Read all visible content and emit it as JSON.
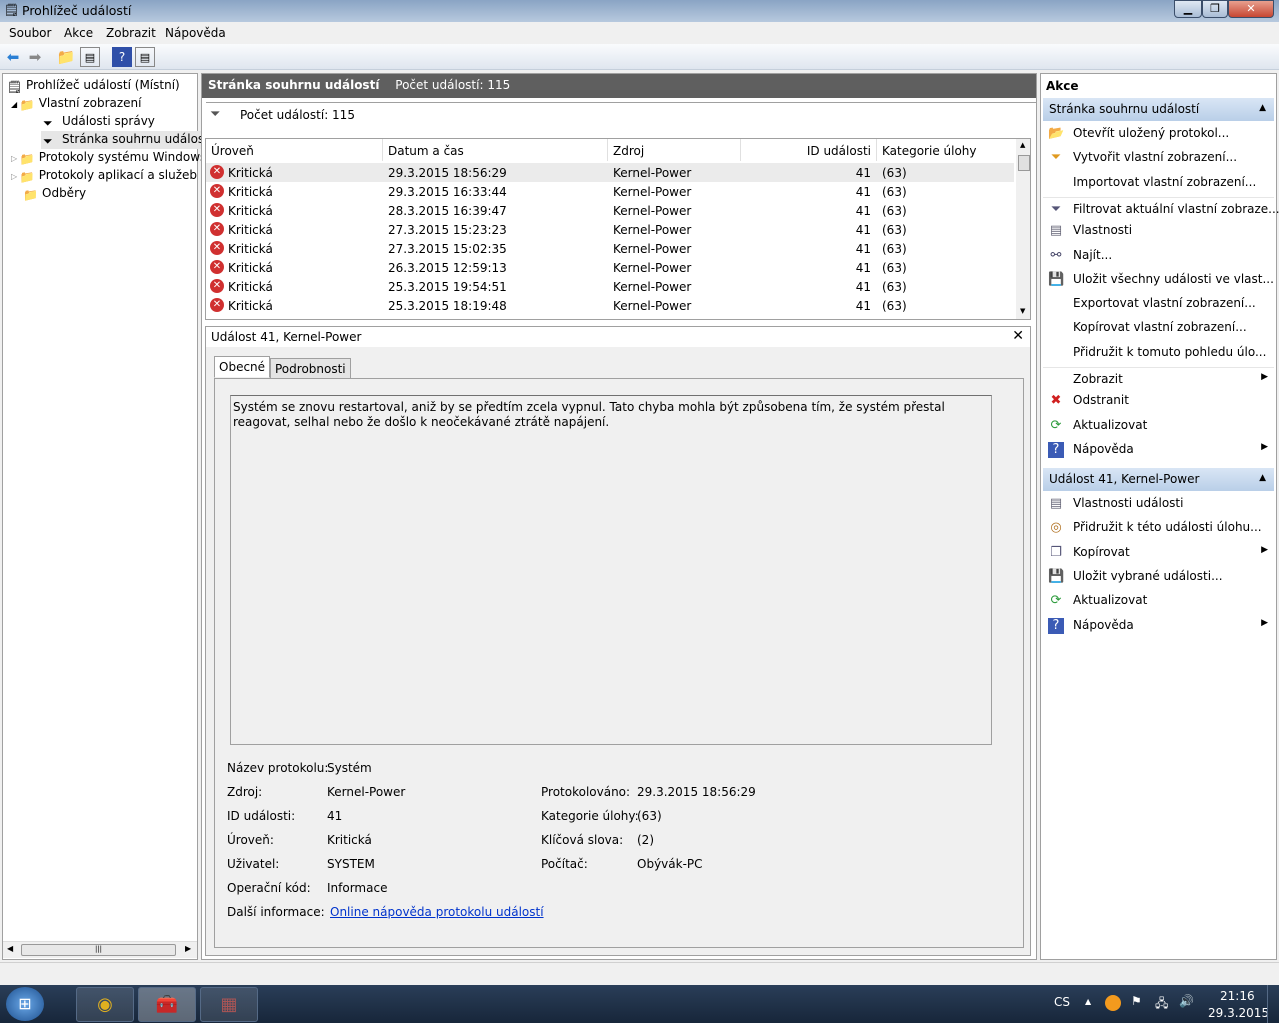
{
  "window": {
    "title": "Prohlížeč událostí"
  },
  "menu": [
    "Soubor",
    "Akce",
    "Zobrazit",
    "Nápověda"
  ],
  "tree": {
    "root": "Prohlížeč událostí (Místní)",
    "custom_views": "Vlastní zobrazení",
    "admin_events": "Události správy",
    "summary_page": "Stránka souhrnu událostí",
    "windows_logs": "Protokoly systému Windows",
    "app_logs": "Protokoly aplikací a služeb",
    "subscriptions": "Odběry"
  },
  "center": {
    "title": "Stránka souhrnu událostí",
    "count_header": "Počet událostí: 115",
    "count_line": "Počet událostí: 115",
    "columns": [
      "Úroveň",
      "Datum a čas",
      "Zdroj",
      "ID události",
      "Kategorie úlohy"
    ],
    "rows": [
      [
        "Kritická",
        "29.3.2015 18:56:29",
        "Kernel-Power",
        "41",
        "(63)"
      ],
      [
        "Kritická",
        "29.3.2015 16:33:44",
        "Kernel-Power",
        "41",
        "(63)"
      ],
      [
        "Kritická",
        "28.3.2015 16:39:47",
        "Kernel-Power",
        "41",
        "(63)"
      ],
      [
        "Kritická",
        "27.3.2015 15:23:23",
        "Kernel-Power",
        "41",
        "(63)"
      ],
      [
        "Kritická",
        "27.3.2015 15:02:35",
        "Kernel-Power",
        "41",
        "(63)"
      ],
      [
        "Kritická",
        "26.3.2015 12:59:13",
        "Kernel-Power",
        "41",
        "(63)"
      ],
      [
        "Kritická",
        "25.3.2015 19:54:51",
        "Kernel-Power",
        "41",
        "(63)"
      ],
      [
        "Kritická",
        "25.3.2015 18:19:48",
        "Kernel-Power",
        "41",
        "(63)"
      ]
    ]
  },
  "detail": {
    "title": "Událost 41, Kernel-Power",
    "tabs": [
      "Obecné",
      "Podrobnosti"
    ],
    "description": "Systém se znovu restartoval, aniž by se předtím zcela vypnul. Tato chyba mohla být způsobena tím, že systém přestal reagovat, selhal nebo že došlo k neočekávané ztrátě napájení.",
    "props_left": [
      [
        "Název protokolu:",
        "Systém"
      ],
      [
        "Zdroj:",
        "Kernel-Power"
      ],
      [
        "ID události:",
        "41"
      ],
      [
        "Úroveň:",
        "Kritická"
      ],
      [
        "Uživatel:",
        "SYSTEM"
      ],
      [
        "Operační kód:",
        "Informace"
      ]
    ],
    "props_right": [
      [
        "Protokolováno:",
        "29.3.2015 18:56:29"
      ],
      [
        "Kategorie úlohy:",
        "(63)"
      ],
      [
        "Klíčová slova:",
        "(2)"
      ],
      [
        "Počítač:",
        "Obývák-PC"
      ]
    ],
    "more_info_label": "Další informace:",
    "more_info_link": "Online nápověda protokolu událostí"
  },
  "actions": {
    "title": "Akce",
    "section1": "Stránka souhrnu událostí",
    "items1": [
      {
        "icon": "open-folder",
        "label": "Otevřít uložený protokol..."
      },
      {
        "icon": "funnel-new",
        "label": "Vytvořit vlastní zobrazení..."
      },
      {
        "icon": "",
        "label": "Importovat vlastní zobrazení..."
      },
      {
        "icon": "funnel",
        "label": "Filtrovat aktuální vlastní zobraze..."
      },
      {
        "icon": "properties",
        "label": "Vlastnosti"
      },
      {
        "icon": "binoculars",
        "label": "Najít..."
      },
      {
        "icon": "save",
        "label": "Uložit všechny události ve vlast..."
      },
      {
        "icon": "",
        "label": "Exportovat vlastní zobrazení..."
      },
      {
        "icon": "",
        "label": "Kopírovat vlastní zobrazení..."
      },
      {
        "icon": "",
        "label": "Přidružit k tomuto pohledu úlo..."
      },
      {
        "icon": "",
        "label": "Zobrazit",
        "submenu": true
      },
      {
        "icon": "delete",
        "label": "Odstranit"
      },
      {
        "icon": "refresh",
        "label": "Aktualizovat"
      },
      {
        "icon": "help",
        "label": "Nápověda",
        "submenu": true
      }
    ],
    "section2": "Událost 41, Kernel-Power",
    "items2": [
      {
        "icon": "properties",
        "label": "Vlastnosti události"
      },
      {
        "icon": "task",
        "label": "Přidružit k této události úlohu..."
      },
      {
        "icon": "copy",
        "label": "Kopírovat",
        "submenu": true
      },
      {
        "icon": "save",
        "label": "Uložit vybrané události..."
      },
      {
        "icon": "refresh",
        "label": "Aktualizovat"
      },
      {
        "icon": "help",
        "label": "Nápověda",
        "submenu": true
      }
    ]
  },
  "tray": {
    "lang": "CS",
    "time": "21:16",
    "date": "29.3.2015"
  }
}
